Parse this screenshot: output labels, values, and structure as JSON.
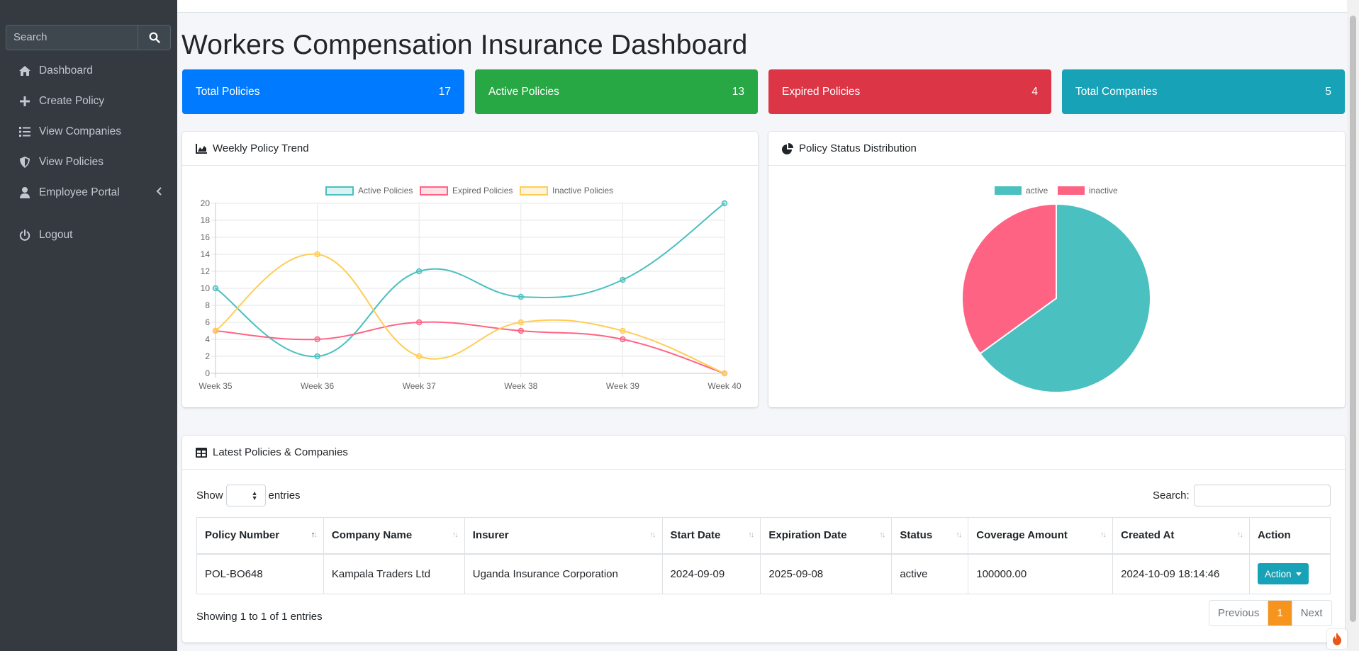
{
  "sidebar": {
    "search_placeholder": "Search",
    "items": [
      {
        "label": "Dashboard",
        "icon": "home-icon"
      },
      {
        "label": "Create Policy",
        "icon": "plus-icon"
      },
      {
        "label": "View Companies",
        "icon": "list-icon"
      },
      {
        "label": "View Policies",
        "icon": "shield-icon"
      },
      {
        "label": "Employee Portal",
        "icon": "user-icon"
      },
      {
        "label": "Logout",
        "icon": "power-icon"
      }
    ]
  },
  "page_title": "Workers Compensation Insurance Dashboard",
  "stats": [
    {
      "label": "Total Policies",
      "value": "17",
      "color": "#007bff"
    },
    {
      "label": "Active Policies",
      "value": "13",
      "color": "#28a745"
    },
    {
      "label": "Expired Policies",
      "value": "4",
      "color": "#dc3545"
    },
    {
      "label": "Total Companies",
      "value": "5",
      "color": "#17a2b8"
    }
  ],
  "trend_card": {
    "title": "Weekly Policy Trend"
  },
  "status_card": {
    "title": "Policy Status Distribution"
  },
  "chart_data": [
    {
      "type": "line",
      "categories": [
        "Week 35",
        "Week 36",
        "Week 37",
        "Week 38",
        "Week 39",
        "Week 40"
      ],
      "ylim": [
        0,
        20
      ],
      "yticks": [
        0,
        2,
        4,
        6,
        8,
        10,
        12,
        14,
        16,
        18,
        20
      ],
      "grid": true,
      "legend": "top",
      "series": [
        {
          "name": "Active Policies",
          "values": [
            10,
            2,
            12,
            9,
            11,
            20
          ],
          "color": "#4bc0c0"
        },
        {
          "name": "Expired Policies",
          "values": [
            5,
            4,
            6,
            5,
            4,
            0
          ],
          "color": "#ff6384"
        },
        {
          "name": "Inactive Policies",
          "values": [
            5,
            14,
            2,
            6,
            5,
            0
          ],
          "color": "#ffcd56"
        }
      ]
    },
    {
      "type": "pie",
      "categories": [
        "active",
        "inactive"
      ],
      "values": [
        13,
        7
      ],
      "colors": [
        "#4bc0c0",
        "#ff6384"
      ],
      "legend": "top"
    }
  ],
  "table_card": {
    "title": "Latest Policies & Companies",
    "show_label": "Show",
    "entries_label": "entries",
    "search_label": "Search:",
    "columns": [
      "Policy Number",
      "Company Name",
      "Insurer",
      "Start Date",
      "Expiration Date",
      "Status",
      "Coverage Amount",
      "Created At",
      "Action"
    ],
    "rows": [
      [
        "POL-BO648",
        "Kampala Traders Ltd",
        "Uganda Insurance Corporation",
        "2024-09-09",
        "2025-09-08",
        "active",
        "100000.00",
        "2024-10-09 18:14:46",
        "Action"
      ]
    ],
    "info": "Showing 1 to 1 of 1 entries",
    "pager": {
      "prev": "Previous",
      "page": "1",
      "next": "Next"
    }
  }
}
